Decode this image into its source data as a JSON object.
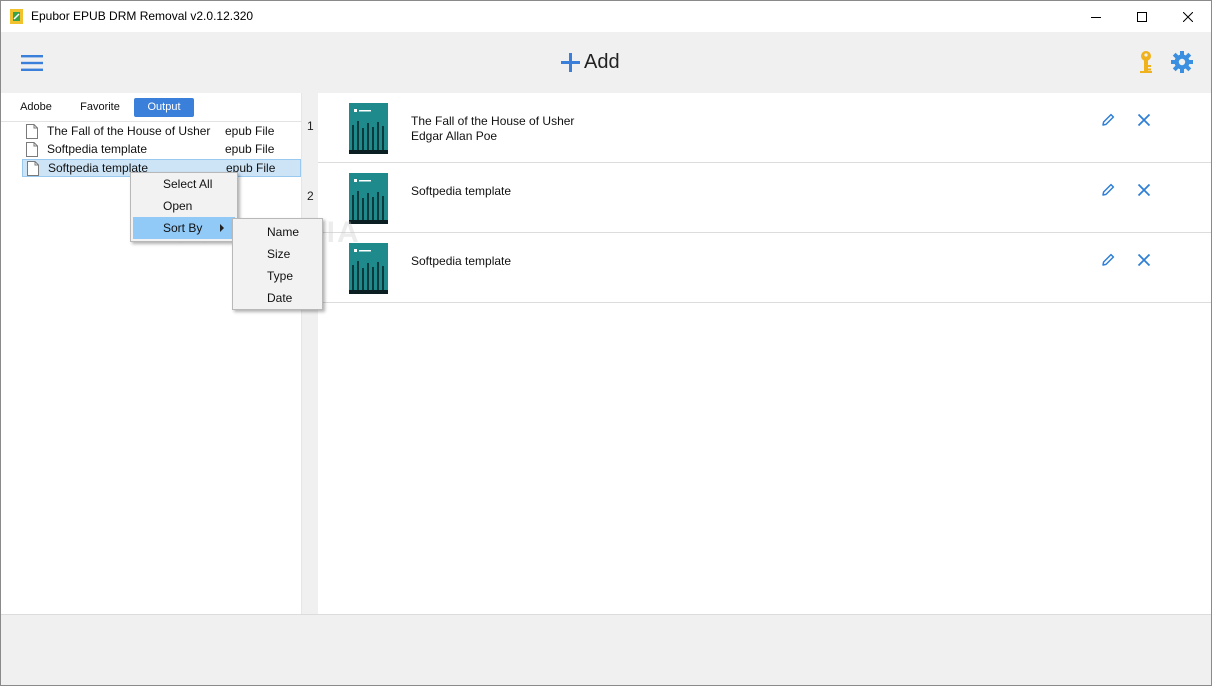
{
  "window": {
    "title": "Epubor EPUB DRM Removal v2.0.12.320"
  },
  "header": {
    "add_label": "Add"
  },
  "tabs": [
    {
      "label": "Adobe"
    },
    {
      "label": "Favorite"
    },
    {
      "label": "Output",
      "active": true
    }
  ],
  "files": [
    {
      "name": "The Fall of the House of Usher",
      "type": "epub File"
    },
    {
      "name": "Softpedia template",
      "type": "epub File"
    },
    {
      "name": "Softpedia template",
      "type": "epub File",
      "selected": true
    }
  ],
  "books": [
    {
      "number": "1",
      "title": "The Fall of the House of Usher",
      "author": "Edgar Allan Poe"
    },
    {
      "number": "2",
      "title": "Softpedia template",
      "author": ""
    },
    {
      "number": "",
      "title": "Softpedia template",
      "author": ""
    }
  ],
  "context_menu": {
    "items": [
      {
        "label": "Select All"
      },
      {
        "label": "Open"
      },
      {
        "label": "Sort By",
        "highlighted": true,
        "has_submenu": true
      }
    ]
  },
  "sort_submenu": {
    "items": [
      {
        "label": "Name"
      },
      {
        "label": "Size"
      },
      {
        "label": "Type"
      },
      {
        "label": "Date"
      }
    ]
  },
  "watermark": "SOFTPEDIA",
  "colors": {
    "accent": "#3a7fd9",
    "icon_blue": "#2f7fd6",
    "key_gold": "#f0b21c",
    "cover_teal": "#1f8a8c",
    "selection": "#cde4f7",
    "menu_highlight": "#91c9f7"
  },
  "icons": {
    "app": "epubor-app-icon",
    "menu": "hamburger-icon",
    "add": "plus-icon",
    "key": "key-icon",
    "settings": "gear-icon",
    "file": "file-icon",
    "edit": "pencil-icon",
    "remove": "close-icon"
  }
}
